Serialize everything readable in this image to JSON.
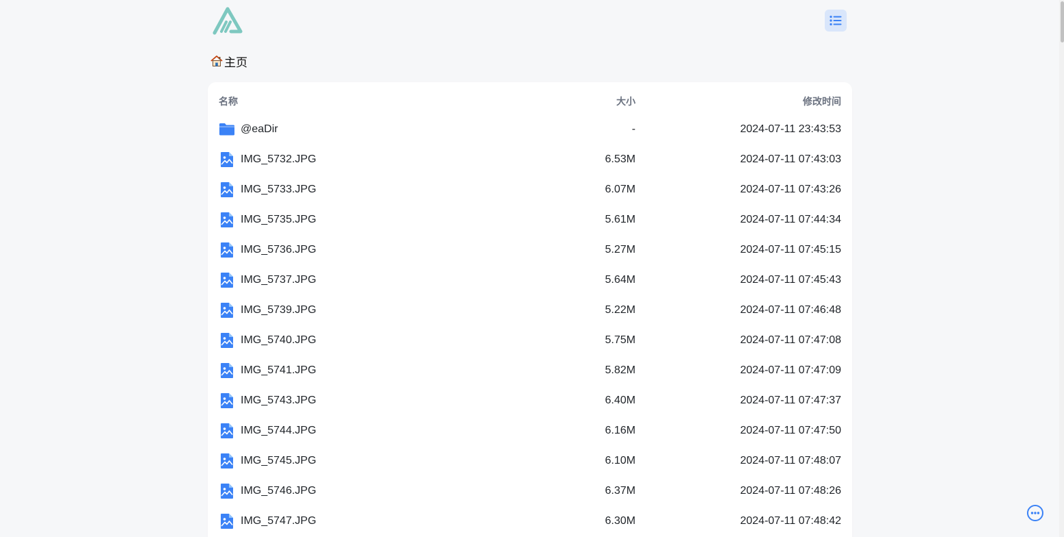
{
  "header": {
    "logo_icon": "alist-logo",
    "layout_toggle_icon": "list-icon"
  },
  "breadcrumb": {
    "home_icon": "house-icon",
    "label": "主页"
  },
  "table": {
    "headers": {
      "name": "名称",
      "size": "大小",
      "modified": "修改时间"
    },
    "rows": [
      {
        "icon": "folder-icon",
        "name": "@eaDir",
        "size": "-",
        "modified": "2024-07-11 23:43:53"
      },
      {
        "icon": "image-file-icon",
        "name": "IMG_5732.JPG",
        "size": "6.53M",
        "modified": "2024-07-11 07:43:03"
      },
      {
        "icon": "image-file-icon",
        "name": "IMG_5733.JPG",
        "size": "6.07M",
        "modified": "2024-07-11 07:43:26"
      },
      {
        "icon": "image-file-icon",
        "name": "IMG_5735.JPG",
        "size": "5.61M",
        "modified": "2024-07-11 07:44:34"
      },
      {
        "icon": "image-file-icon",
        "name": "IMG_5736.JPG",
        "size": "5.27M",
        "modified": "2024-07-11 07:45:15"
      },
      {
        "icon": "image-file-icon",
        "name": "IMG_5737.JPG",
        "size": "5.64M",
        "modified": "2024-07-11 07:45:43"
      },
      {
        "icon": "image-file-icon",
        "name": "IMG_5739.JPG",
        "size": "5.22M",
        "modified": "2024-07-11 07:46:48"
      },
      {
        "icon": "image-file-icon",
        "name": "IMG_5740.JPG",
        "size": "5.75M",
        "modified": "2024-07-11 07:47:08"
      },
      {
        "icon": "image-file-icon",
        "name": "IMG_5741.JPG",
        "size": "5.82M",
        "modified": "2024-07-11 07:47:09"
      },
      {
        "icon": "image-file-icon",
        "name": "IMG_5743.JPG",
        "size": "6.40M",
        "modified": "2024-07-11 07:47:37"
      },
      {
        "icon": "image-file-icon",
        "name": "IMG_5744.JPG",
        "size": "6.16M",
        "modified": "2024-07-11 07:47:50"
      },
      {
        "icon": "image-file-icon",
        "name": "IMG_5745.JPG",
        "size": "6.10M",
        "modified": "2024-07-11 07:48:07"
      },
      {
        "icon": "image-file-icon",
        "name": "IMG_5746.JPG",
        "size": "6.37M",
        "modified": "2024-07-11 07:48:26"
      },
      {
        "icon": "image-file-icon",
        "name": "IMG_5747.JPG",
        "size": "6.30M",
        "modified": "2024-07-11 07:48:42"
      }
    ]
  },
  "fab": {
    "icon": "more-options-icon"
  },
  "colors": {
    "accent": "#3b82f6",
    "background": "#f6f7f9",
    "card": "#ffffff",
    "logo": "#7ec8c0",
    "toggle_bg": "#d9e6fb"
  }
}
